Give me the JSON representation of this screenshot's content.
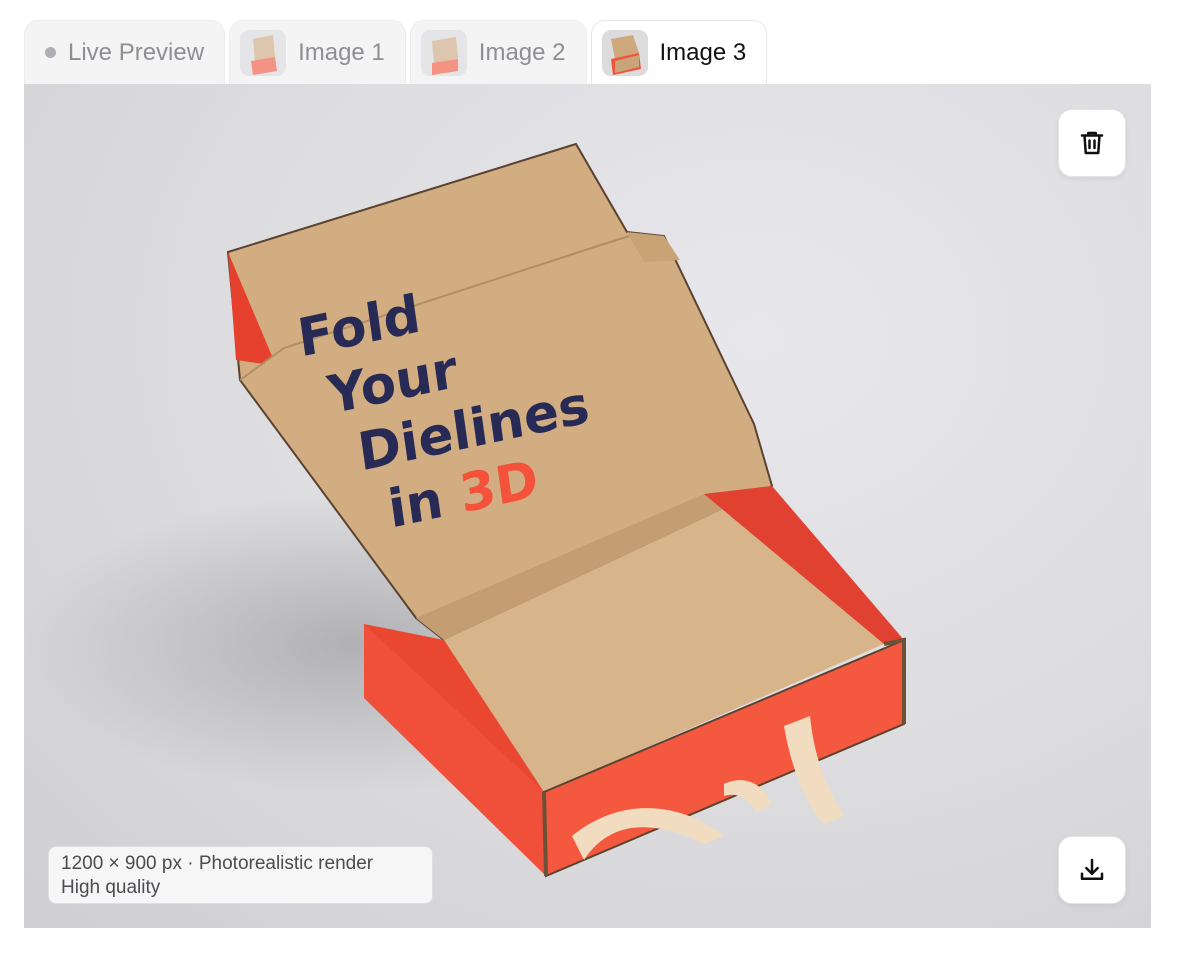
{
  "tabs": [
    {
      "label": "Live Preview",
      "icon": "dot-icon",
      "active": false
    },
    {
      "label": "Image 1",
      "icon": "thumbnail",
      "active": false
    },
    {
      "label": "Image 2",
      "icon": "thumbnail",
      "active": false
    },
    {
      "label": "Image 3",
      "icon": "thumbnail",
      "active": true
    }
  ],
  "viewer": {
    "box_print": {
      "line1": "Fold",
      "line2": "Your",
      "line3": "Dielines",
      "line4_in": "in",
      "line4_3d": "3D"
    },
    "info": {
      "line1": "1200 × 900 px · Photorealistic render",
      "line2": "High quality"
    },
    "actions": {
      "delete_icon": "trash-icon",
      "download_icon": "download-icon"
    }
  },
  "colors": {
    "box_red": "#f4523a",
    "kraft": "#cfa97e",
    "text_navy": "#262a55",
    "accent_3d": "#f4523a"
  }
}
